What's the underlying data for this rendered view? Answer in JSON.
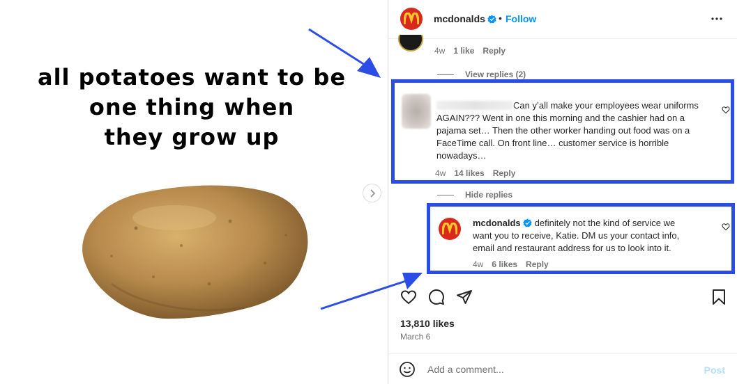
{
  "meme": {
    "lines": [
      "all potatoes want to be",
      "one thing when",
      "they grow up"
    ]
  },
  "post": {
    "username": "mcdonalds",
    "follow_label": "Follow",
    "dot": "•",
    "likes": "13,810 likes",
    "date": "March 6"
  },
  "prev_comment": {
    "time": "4w",
    "likes": "1 like",
    "reply": "Reply"
  },
  "view_replies": "View replies (2)",
  "comment1": {
    "text_first": "Can y’all make your employees wear uniforms",
    "text_rest": [
      "AGAIN??? Went in one this morning and the cashier had on a",
      "pajama set… Then the other worker handing out food was on a",
      "FaceTime call. On front line… customer service is horrible",
      "nowadays…"
    ],
    "time": "4w",
    "likes": "14 likes",
    "reply": "Reply"
  },
  "hide_replies": "Hide replies",
  "comment2": {
    "username": "mcdonalds",
    "text_first": "definitely not the kind of service we",
    "text_rest": [
      "want you to receive, Katie. DM us your contact info,",
      "email and restaurant address for us to look into it."
    ],
    "time": "4w",
    "likes": "6 likes",
    "reply": "Reply"
  },
  "add_comment": {
    "placeholder": "Add a comment...",
    "post_label": "Post"
  },
  "colors": {
    "highlight_box": "#2b4de6",
    "brand_red": "#da291c",
    "brand_yellow": "#ffc72c",
    "link_blue": "#0095f6",
    "verified_blue": "#0095f6"
  },
  "icons": [
    "mcdonalds-logo-icon",
    "verified-badge-icon",
    "more-options-icon",
    "heart-icon",
    "comment-icon",
    "share-icon",
    "bookmark-icon",
    "emoji-icon",
    "chevron-right-icon",
    "arrow-annotation-icon"
  ]
}
